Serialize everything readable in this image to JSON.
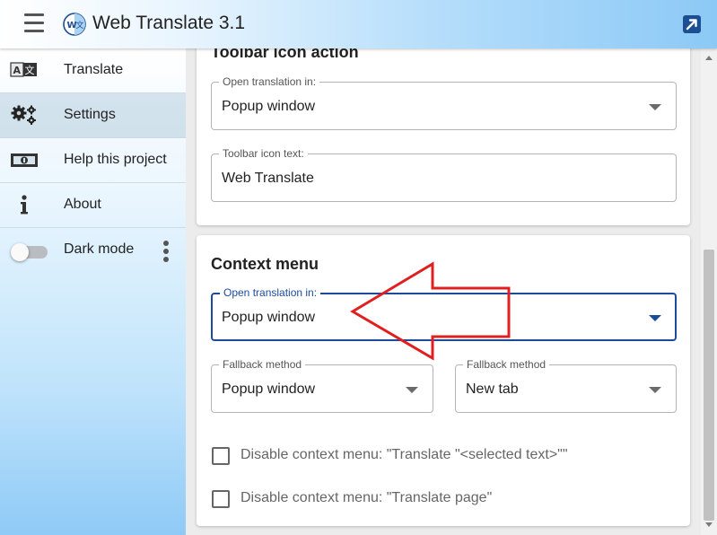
{
  "header": {
    "title": "Web Translate 3.1"
  },
  "sidebar": {
    "items": [
      {
        "label": "Translate",
        "icon": "translate-icon"
      },
      {
        "label": "Settings",
        "icon": "gears-icon",
        "active": true
      },
      {
        "label": "Help this project",
        "icon": "money-bill-icon"
      },
      {
        "label": "About",
        "icon": "info-icon"
      }
    ],
    "dark_mode": {
      "label": "Dark mode",
      "enabled": false
    },
    "translate_icon_text": {
      "left": "A",
      "right": "文"
    }
  },
  "toolbar_section": {
    "title": "Toolbar icon action",
    "open_translation": {
      "label": "Open translation in:",
      "value": "Popup window"
    },
    "icon_text": {
      "label": "Toolbar icon text:",
      "value": "Web Translate"
    }
  },
  "context_section": {
    "title": "Context menu",
    "open_translation": {
      "label": "Open translation in:",
      "value": "Popup window"
    },
    "fallback_1": {
      "label": "Fallback method",
      "value": "Popup window"
    },
    "fallback_2": {
      "label": "Fallback method",
      "value": "New tab"
    },
    "checkbox_selected": {
      "label": "Disable context menu: \"Translate \"<selected text>\"\"",
      "checked": false
    },
    "checkbox_page": {
      "label": "Disable context menu: \"Translate page\"",
      "checked": false
    }
  },
  "colors": {
    "accent": "#1c4b9c",
    "annotation": "#e02020"
  }
}
